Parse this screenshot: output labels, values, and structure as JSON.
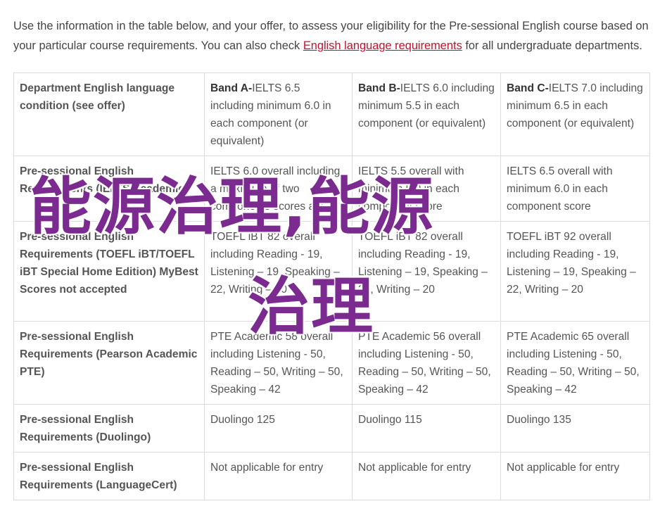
{
  "intro": {
    "text_before": "Use the information in the table below, and your offer, to assess your eligibility for the Pre-sessional English course based on your particular course requirements. You can also check ",
    "link": "English language requirements",
    "text_after": " for all undergraduate departments."
  },
  "table": {
    "header": {
      "label": "Department English language condition (see offer)",
      "cols": [
        {
          "band": "Band A-",
          "text": "IELTS 6.5 including minimum 6.0 in each component (or equivalent)"
        },
        {
          "band": "Band B-",
          "text": "IELTS 6.0 including minimum 5.5 in each component (or equivalent)"
        },
        {
          "band": "Band C-",
          "text": "IELTS 7.0 including minimum 6.5 in each component (or equivalent)"
        }
      ]
    },
    "rows": [
      {
        "label": "Pre-sessional English Requirements (IELTS Academic)",
        "cells": [
          "IELTS 6.0 overall including a maximum of two components scores at 5.5",
          "IELTS 5.5 overall with minimum 5.0 in each component score",
          "IELTS 6.5 overall with minimum 6.0 in each component score"
        ]
      },
      {
        "label": "Pre-sessional English Requirements (TOEFL iBT/TOEFL iBT Special Home Edition) MyBest Scores not accepted",
        "cells": [
          "TOEFL iBT 82 overall including Reading - 19, Listening – 19, Speaking – 22, Writing – 20",
          "TOEFL iBT 82 overall including Reading - 19, Listening – 19, Speaking – 22, Writing – 20",
          "TOEFL iBT 92 overall including Reading - 19, Listening – 19, Speaking – 22, Writing – 20"
        ]
      },
      {
        "label": "Pre-sessional English Requirements (Pearson Academic PTE)",
        "cells": [
          "PTE Academic 58 overall including Listening - 50, Reading – 50, Writing – 50, Speaking – 42",
          "PTE Academic 56 overall including Listening - 50, Reading – 50, Writing – 50, Speaking – 42",
          "PTE Academic 65 overall including Listening - 50, Reading – 50, Writing – 50, Speaking – 42"
        ]
      },
      {
        "label": "Pre-sessional English Requirements (Duolingo)",
        "cells": [
          "Duolingo 125",
          "Duolingo 115",
          "Duolingo 135"
        ]
      },
      {
        "label": "Pre-sessional English Requirements (LanguageCert)",
        "cells": [
          "Not applicable for entry",
          "Not applicable for entry",
          "Not applicable for entry"
        ]
      }
    ]
  },
  "watermark": {
    "line1": "能源治理,能源",
    "line2": "治理",
    "color": "#7b2b8f"
  },
  "colors": {
    "link": "#c8102e",
    "text": "#444444",
    "border": "#dcdcdc"
  }
}
